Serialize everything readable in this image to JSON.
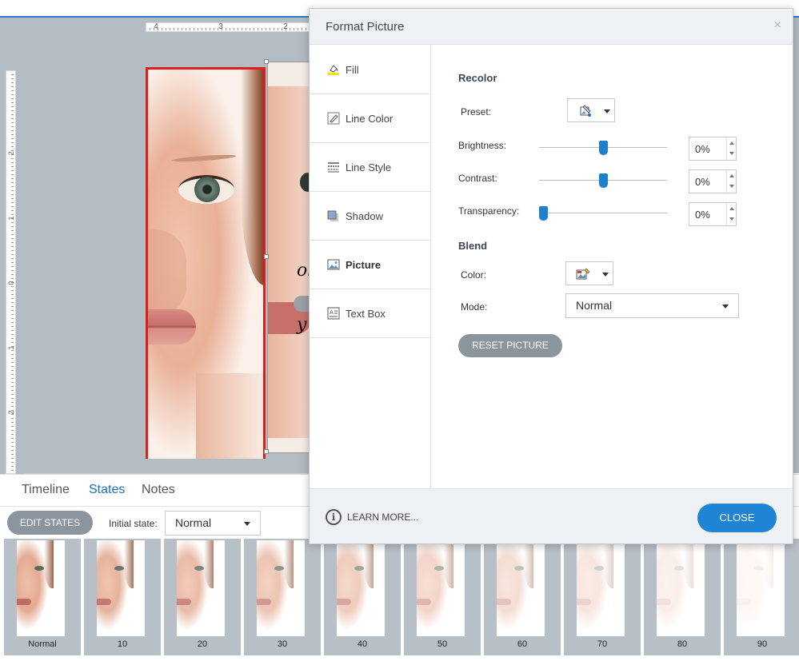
{
  "ruler": {
    "horizontal": [
      "4",
      "3",
      "2"
    ],
    "vertical": [
      "2",
      "1",
      "0",
      "1",
      "2",
      "3"
    ]
  },
  "canvas": {
    "script_text": [
      "ol",
      "y"
    ]
  },
  "bottom_panel": {
    "tabs": [
      {
        "label": "Timeline",
        "active": false
      },
      {
        "label": "States",
        "active": true
      },
      {
        "label": "Notes",
        "active": false
      }
    ],
    "edit_states_label": "EDIT STATES",
    "initial_state_label": "Initial state:",
    "initial_state_value": "Normal",
    "states": [
      {
        "label": "Normal",
        "fade": 0
      },
      {
        "label": "10",
        "fade": 0.1
      },
      {
        "label": "20",
        "fade": 0.2
      },
      {
        "label": "30",
        "fade": 0.3
      },
      {
        "label": "40",
        "fade": 0.4
      },
      {
        "label": "50",
        "fade": 0.5
      },
      {
        "label": "60",
        "fade": 0.6
      },
      {
        "label": "70",
        "fade": 0.7
      },
      {
        "label": "80",
        "fade": 0.8
      },
      {
        "label": "90",
        "fade": 0.9
      }
    ]
  },
  "dialog": {
    "title": "Format Picture",
    "close_x": "×",
    "nav": [
      {
        "label": "Fill",
        "icon": "paint-bucket-icon",
        "active": false
      },
      {
        "label": "Line Color",
        "icon": "pencil-icon",
        "active": false
      },
      {
        "label": "Line Style",
        "icon": "line-style-icon",
        "active": false
      },
      {
        "label": "Shadow",
        "icon": "shadow-icon",
        "active": false
      },
      {
        "label": "Picture",
        "icon": "picture-icon",
        "active": true
      },
      {
        "label": "Text Box",
        "icon": "text-box-icon",
        "active": false
      }
    ],
    "recolor": {
      "title": "Recolor",
      "preset_label": "Preset:",
      "preset_icon": "recolor-preset-icon",
      "brightness": {
        "label": "Brightness:",
        "value": "0%",
        "position": 0.5
      },
      "contrast": {
        "label": "Contrast:",
        "value": "0%",
        "position": 0.5
      },
      "transparency": {
        "label": "Transparency:",
        "value": "0%",
        "position": 0.03
      }
    },
    "blend": {
      "title": "Blend",
      "color_label": "Color:",
      "color_icon": "blend-color-icon",
      "mode_label": "Mode:",
      "mode_value": "Normal"
    },
    "reset_label": "RESET PICTURE",
    "learn_more_label": "LEARN MORE...",
    "close_label": "CLOSE"
  },
  "colors": {
    "accent": "#1e84d3",
    "selection": "#e21b1b",
    "gray_button": "#8b959e"
  }
}
